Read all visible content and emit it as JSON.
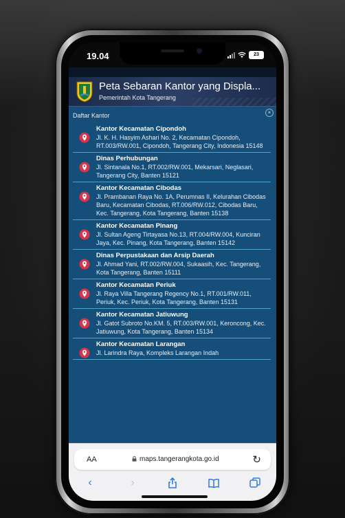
{
  "status_bar": {
    "time": "19.04",
    "battery": "23"
  },
  "header": {
    "title": "Peta Sebaran Kantor yang Displa...",
    "subtitle": "Pemerintah Kota Tangerang"
  },
  "panel": {
    "title": "Daftar Kantor",
    "items": [
      {
        "name": "Kantor Kecamatan Cipondoh",
        "address": "Jl. K. H. Hasyim Ashari No. 2, Kecamatan Cipondoh, RT.003/RW.001, Cipondoh, Tangerang City, Indonesia 15148"
      },
      {
        "name": "Dinas Perhubungan",
        "address": "Jl. Sintanala No.1, RT.002/RW.001, Mekarsari, Neglasari, Tangerang City, Banten 15121"
      },
      {
        "name": "Kantor Kecamatan Cibodas",
        "address": "Jl. Prambanan Raya No. 1A, Perumnas II, Kelurahan Cibodas Baru, Kecamatan Cibodas, RT.006/RW.012, Cibodas Baru, Kec. Tangerang, Kota Tangerang, Banten 15138"
      },
      {
        "name": "Kantor Kecamatan Pinang",
        "address": "Jl. Sultan Ageng Tirtayasa No.13, RT.004/RW.004, Kunciran Jaya, Kec. Pinang, Kota Tangerang, Banten 15142"
      },
      {
        "name": "Dinas Perpustakaan dan Arsip Daerah",
        "address": "Jl. Ahmad Yani, RT.002/RW.004, Sukaasih, Kec. Tangerang, Kota Tangerang, Banten 15111"
      },
      {
        "name": "Kantor Kecamatan Periuk",
        "address": "Jl. Raya Villa Tangerang Regency No.1, RT.001/RW.011, Periuk, Kec. Periuk, Kota Tangerang, Banten 15131"
      },
      {
        "name": "Kantor Kecamatan Jatiuwung",
        "address": "Jl. Gatot Subroto No.KM. 5, RT.003/RW.001, Keroncong, Kec. Jatiuwung, Kota Tangerang, Banten 15134"
      },
      {
        "name": "Kantor Kecamatan Larangan",
        "address": "Jl. Larindra Raya, Kompleks Larangan Indah"
      }
    ]
  },
  "browser": {
    "text_size_label": "AA",
    "url": "maps.tangerangkota.go.id"
  },
  "colors": {
    "panel_bg": "#164e7a",
    "divider": "#4fa6c8",
    "pin": "#d8344a",
    "browser_accent": "#2f7be5"
  }
}
